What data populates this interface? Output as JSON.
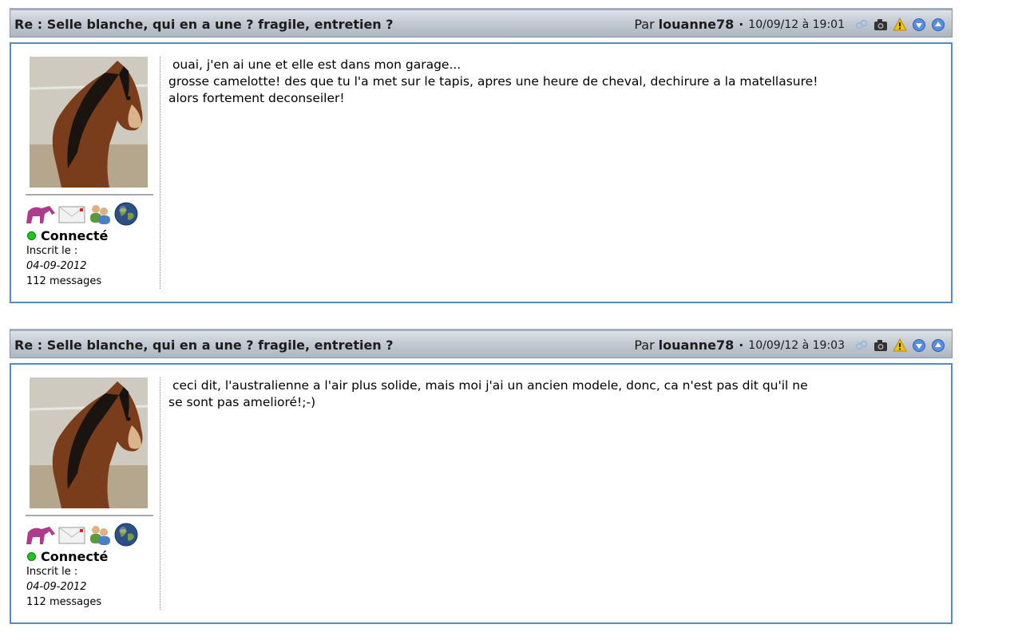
{
  "posts": [
    {
      "title": "Re : Selle blanche, qui en a une ? fragile, entretien ?",
      "by_label": "Par",
      "author": "louanne78",
      "separator": "·",
      "date": "10/09/12 à 19:01",
      "status": "Connecté",
      "registered_label": "Inscrit le :",
      "registered_date": "04-09-2012",
      "messages": "112 messages",
      "body": " ouai, j'en ai une et elle est dans mon garage...\ngrosse camelotte! des que tu l'a met sur le tapis, apres une heure de cheval, dechirure a la matellasure!\nalors fortement deconseiler!"
    },
    {
      "title": "Re : Selle blanche, qui en a une ? fragile, entretien ?",
      "by_label": "Par",
      "author": "louanne78",
      "separator": "·",
      "date": "10/09/12 à 19:03",
      "status": "Connecté",
      "registered_label": "Inscrit le :",
      "registered_date": "04-09-2012",
      "messages": "112 messages",
      "body": " ceci dit, l'australienne a l'air plus solide, mais moi j'ai un ancien modele, donc, ca n'est pas dit qu'il ne\nse sont pas amelioré!;-)"
    }
  ],
  "icons": {
    "header": [
      "link-icon",
      "camera-icon",
      "warning-icon",
      "arrow-down-icon",
      "arrow-up-icon"
    ],
    "badges": [
      "horse-badge-icon",
      "envelope-icon",
      "users-icon",
      "globe-icon"
    ]
  },
  "colors": {
    "header_gradient_top": "#dfe3e9",
    "header_gradient_bottom": "#aeb6c1",
    "post_border": "#5b8bbb",
    "online_dot": "#22c422"
  }
}
